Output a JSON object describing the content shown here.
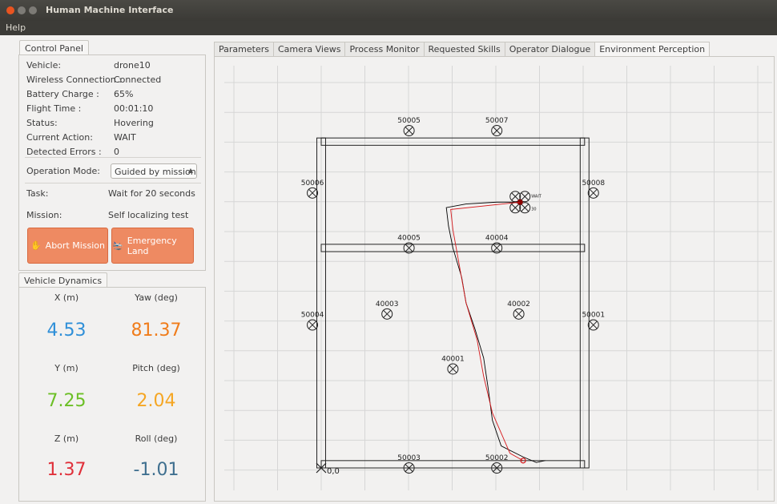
{
  "window": {
    "title": "Human Machine Interface",
    "menu": [
      "Help"
    ]
  },
  "control_panel": {
    "tab_label": "Control Panel",
    "rows": [
      {
        "label": "Vehicle:",
        "value": "drone10"
      },
      {
        "label": "Wireless Connection :",
        "value": "Connected"
      },
      {
        "label": "Battery Charge :",
        "value": "65%"
      },
      {
        "label": "Flight Time :",
        "value": "00:01:10"
      },
      {
        "label": "Status:",
        "value": "Hovering"
      },
      {
        "label": "Current Action:",
        "value": "WAIT"
      },
      {
        "label": "Detected Errors :",
        "value": "0"
      }
    ],
    "operation_mode_label": "Operation Mode:",
    "operation_mode_value": "Guided by mission planner",
    "task_label": "Task:",
    "task_value": "Wait for 20 seconds",
    "mission_label": "Mission:",
    "mission_value": "Self localizing test",
    "abort_label": "Abort Mission",
    "emergency_label": "Emergency Land"
  },
  "vehicle_dynamics": {
    "tab_label": "Vehicle Dynamics",
    "items": [
      {
        "label": "X (m)",
        "value": "4.53",
        "color": "#2f8fd8"
      },
      {
        "label": "Yaw (deg)",
        "value": "81.37",
        "color": "#f07c1a"
      },
      {
        "label": "Y (m)",
        "value": "7.25",
        "color": "#6cbf26"
      },
      {
        "label": "Pitch (deg)",
        "value": "2.04",
        "color": "#f5a623"
      },
      {
        "label": "Z (m)",
        "value": "1.37",
        "color": "#e0303a"
      },
      {
        "label": "Roll (deg)",
        "value": "-1.01",
        "color": "#3f6f8f"
      }
    ]
  },
  "tabs": [
    "Parameters",
    "Camera Views",
    "Process Monitor",
    "Requested Skills",
    "Operator Dialogue",
    "Environment Perception"
  ],
  "active_tab": "Environment Perception",
  "map": {
    "origin_label": "0,0",
    "markers": [
      {
        "id": "50005",
        "x": 2.0,
        "y": 9.2
      },
      {
        "id": "50007",
        "x": 4.0,
        "y": 9.2
      },
      {
        "id": "50006",
        "x": -0.2,
        "y": 7.5
      },
      {
        "id": "50008",
        "x": 6.2,
        "y": 7.5
      },
      {
        "id": "40005",
        "x": 2.0,
        "y": 6.0
      },
      {
        "id": "40004",
        "x": 4.0,
        "y": 6.0
      },
      {
        "id": "40003",
        "x": 1.5,
        "y": 4.2
      },
      {
        "id": "40002",
        "x": 4.5,
        "y": 4.2
      },
      {
        "id": "50004",
        "x": -0.2,
        "y": 3.9
      },
      {
        "id": "50001",
        "x": 6.2,
        "y": 3.9
      },
      {
        "id": "40001",
        "x": 3.0,
        "y": 2.7
      },
      {
        "id": "50003",
        "x": 2.0,
        "y": 0.0
      },
      {
        "id": "50002",
        "x": 4.0,
        "y": 0.0
      }
    ],
    "drone": {
      "x": 4.53,
      "y": 7.25
    },
    "drone_labels": [
      "WAIT",
      "30"
    ],
    "path_colors": {
      "estimated": "#000000",
      "planned": "#d7191c"
    }
  }
}
